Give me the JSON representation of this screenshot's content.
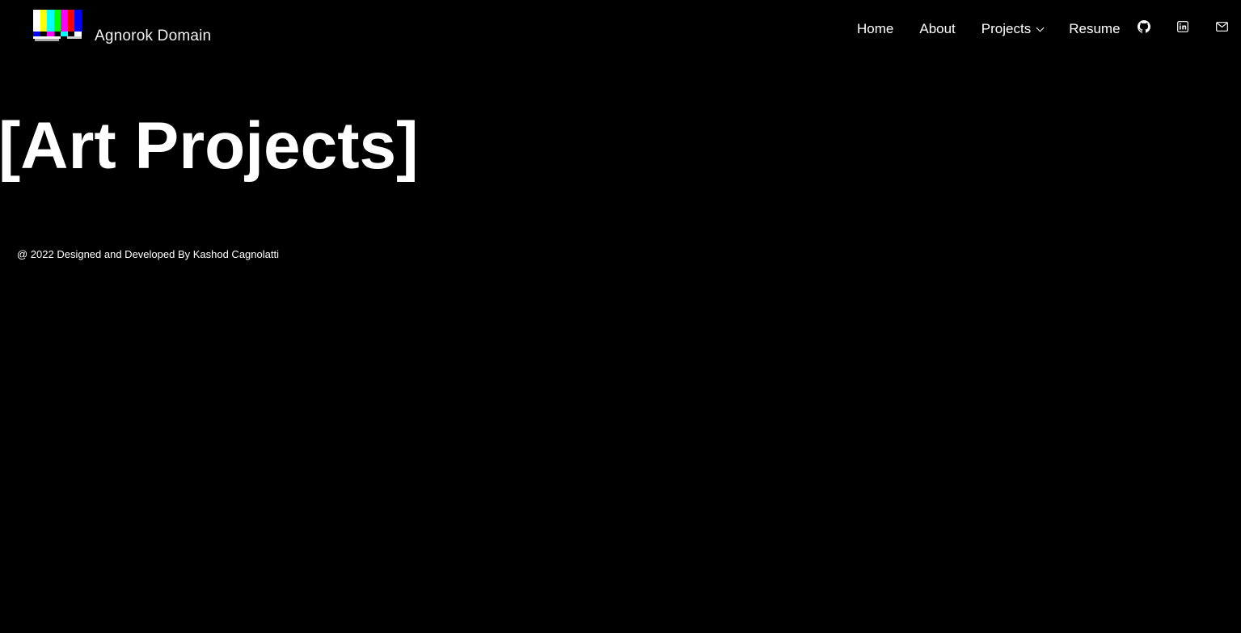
{
  "header": {
    "brand_name": "Agnorok Domain",
    "nav": {
      "home": "Home",
      "about": "About",
      "projects": "Projects",
      "resume": "Resume"
    },
    "icons": [
      "github-icon",
      "linkedin-icon",
      "mail-icon"
    ]
  },
  "main": {
    "title": "[Art Projects]"
  },
  "footer": {
    "text": "@ 2022 Designed and Developed By Kashod Cagnolatti"
  },
  "colors": {
    "background": "#000000",
    "text": "#ffffff",
    "logo_bars": [
      "#ffffff",
      "#ffff00",
      "#00ffff",
      "#00ff00",
      "#ff00ff",
      "#ff0000",
      "#0000ff"
    ]
  }
}
